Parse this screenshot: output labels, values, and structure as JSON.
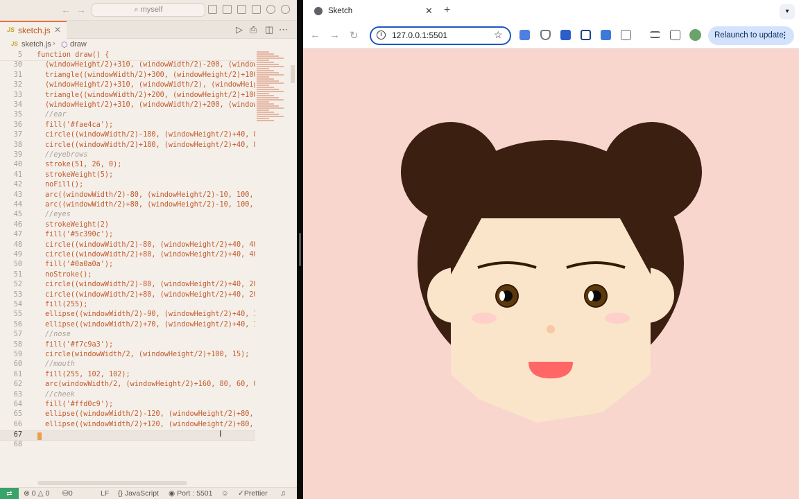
{
  "editor": {
    "search_placeholder": "myself",
    "tab": {
      "icon_text": "JS",
      "name": "sketch.js"
    },
    "breadcrumb": {
      "file": "sketch.js",
      "symbol": "draw"
    },
    "sticky_line": {
      "number": "5",
      "text": "function draw() {"
    },
    "lines": [
      {
        "n": "30",
        "t": "(windowHeight/2)+310, (windowWidth/2)-200, (windowHe"
      },
      {
        "n": "31",
        "t": "triangle((windowWidth/2)+300, (windowHeight/2)+100,"
      },
      {
        "n": "32",
        "t": "(windowHeight/2)+310, (windowWidth/2), (windowHeight"
      },
      {
        "n": "33",
        "t": "triangle((windowWidth/2)+200, (windowHeight/2)+100,"
      },
      {
        "n": "34",
        "t": "(windowHeight/2)+310, (windowWidth/2)+200, (windowHe"
      },
      {
        "n": "35",
        "t": "//ear",
        "comment": true
      },
      {
        "n": "36",
        "t": "fill('#fae4ca');"
      },
      {
        "n": "37",
        "t": "circle((windowWidth/2)-180, (windowHeight/2)+40, 80)"
      },
      {
        "n": "38",
        "t": "circle((windowWidth/2)+180, (windowHeight/2)+40, 80)"
      },
      {
        "n": "39",
        "t": "//eyebrows",
        "comment": true
      },
      {
        "n": "40",
        "t": "stroke(51, 26, 0);"
      },
      {
        "n": "41",
        "t": "strokeWeight(5);"
      },
      {
        "n": "42",
        "t": "noFill();"
      },
      {
        "n": "43",
        "t": "arc((windowWidth/2)-80, (windowHeight/2)-10, 100, 25"
      },
      {
        "n": "44",
        "t": "arc((windowWidth/2)+80, (windowHeight/2)-10, 100, 25"
      },
      {
        "n": "45",
        "t": "//eyes",
        "comment": true
      },
      {
        "n": "46",
        "t": "strokeWeight(2)"
      },
      {
        "n": "47",
        "t": "fill('#5c390c');"
      },
      {
        "n": "48",
        "t": "circle((windowWidth/2)-80, (windowHeight/2)+40, 40);"
      },
      {
        "n": "49",
        "t": "circle((windowWidth/2)+80, (windowHeight/2)+40, 40);"
      },
      {
        "n": "50",
        "t": "fill('#0a0a0a');"
      },
      {
        "n": "51",
        "t": "noStroke();"
      },
      {
        "n": "52",
        "t": "circle((windowWidth/2)-80, (windowHeight/2)+40, 20);"
      },
      {
        "n": "53",
        "t": "circle((windowWidth/2)+80, (windowHeight/2)+40, 20);"
      },
      {
        "n": "54",
        "t": "fill(255);"
      },
      {
        "n": "55",
        "t": "ellipse((windowWidth/2)-90, (windowHeight/2)+40, 10,"
      },
      {
        "n": "56",
        "t": "ellipse((windowWidth/2)+70, (windowHeight/2)+40, 10,"
      },
      {
        "n": "57",
        "t": "//nose",
        "comment": true
      },
      {
        "n": "58",
        "t": "fill('#f7c9a3');"
      },
      {
        "n": "59",
        "t": "circle(windowWidth/2, (windowHeight/2)+100, 15);"
      },
      {
        "n": "60",
        "t": "//mouth",
        "comment": true
      },
      {
        "n": "61",
        "t": "fill(255, 102, 102);"
      },
      {
        "n": "62",
        "t": "arc(windowWidth/2, (windowHeight/2)+160, 80, 60, 0, "
      },
      {
        "n": "63",
        "t": "//cheek",
        "comment": true
      },
      {
        "n": "64",
        "t": "fill('#ffd0c9');"
      },
      {
        "n": "65",
        "t": "ellipse((windowWidth/2)-120, (windowHeight/2)+80, 45"
      },
      {
        "n": "66",
        "t": "ellipse((windowWidth/2)+120, (windowHeight/2)+80, 45"
      },
      {
        "n": "67",
        "t": "",
        "current": true
      },
      {
        "n": "68",
        "t": ""
      }
    ],
    "status": {
      "errors": "0",
      "warnings": "0",
      "ports": "0",
      "eol": "LF",
      "language": "JavaScript",
      "port": "Port : 5501",
      "prettier": "Prettier"
    }
  },
  "browser": {
    "tab_title": "Sketch",
    "url": "127.0.0.1:5501",
    "relaunch_label": "Relaunch to update",
    "sketch_colors": {
      "background": "#f8d5cd",
      "hair": "#3b1f10",
      "face": "#fae4ca",
      "eye": "#5c390c",
      "pupil": "#0a0a0a",
      "nose": "#f7c9a3",
      "mouth": "#ff6666",
      "cheek": "#ffd0c9",
      "brow": "#331a00"
    }
  }
}
